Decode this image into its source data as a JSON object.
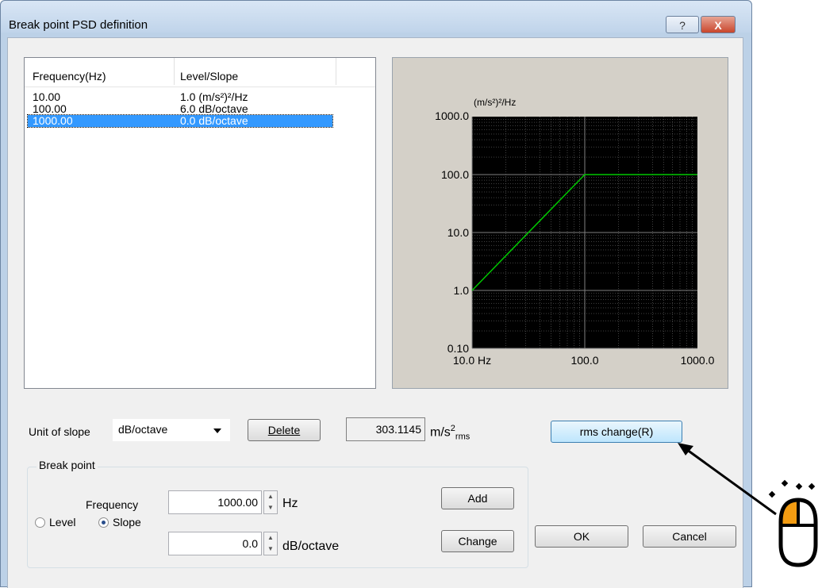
{
  "window": {
    "title": "Break point PSD definition",
    "help_label": "?",
    "close_label": "X"
  },
  "list": {
    "headers": [
      "Frequency(Hz)",
      "Level/Slope"
    ],
    "rows": [
      {
        "freq": "10.00",
        "value": "1.0 (m/s²)²/Hz"
      },
      {
        "freq": "100.00",
        "value": "6.0  dB/octave"
      },
      {
        "freq": "1000.00",
        "value": "0.0  dB/octave",
        "selected": true
      }
    ]
  },
  "chart_data": {
    "type": "line",
    "scale": "log-log",
    "x": [
      10,
      100,
      1000
    ],
    "series": [
      {
        "values": [
          1.0,
          100.0,
          100.0
        ],
        "color": "#00c800"
      }
    ],
    "xlim": [
      10,
      1000
    ],
    "ylim": [
      0.1,
      1000
    ],
    "yunit": "(m/s²)²/Hz",
    "ytick_labels": [
      "1000.0",
      "100.0",
      "10.0",
      "1.0",
      "0.10"
    ],
    "xtick_labels": [
      "10.0 Hz",
      "100.0",
      "1000.0"
    ],
    "grid": true,
    "background": "#000000",
    "grid_color": "#808080"
  },
  "controls": {
    "unit_of_slope_label": "Unit of slope",
    "unit_of_slope_value": "dB/octave",
    "delete_label": "Delete",
    "rms_value": "303.1145",
    "rms_unit": "m/s",
    "rms_sup": "2",
    "rms_sub": "rms",
    "rms_change_label": "rms change(R)",
    "breakpoint_group_label": "Break point",
    "frequency_label": "Frequency",
    "frequency_value": "1000.00",
    "frequency_unit": "Hz",
    "level_label": "Level",
    "slope_label": "Slope",
    "slope_value": "0.0",
    "slope_unit": "dB/octave",
    "add_label": "Add",
    "change_label": "Change",
    "ok_label": "OK",
    "cancel_label": "Cancel"
  }
}
